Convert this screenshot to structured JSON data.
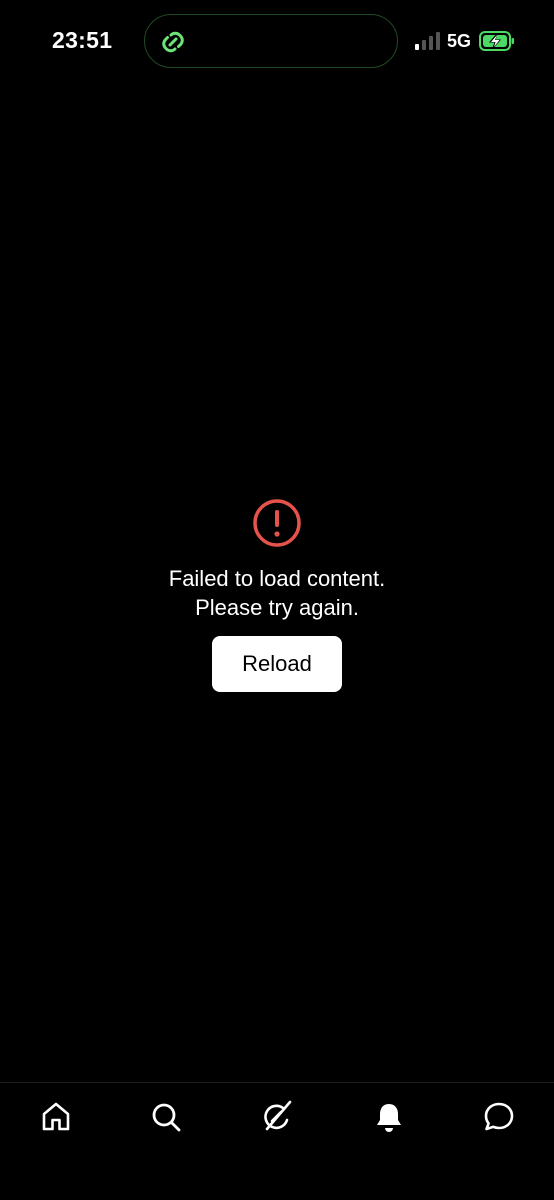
{
  "status_bar": {
    "time": "23:51",
    "network": "5G",
    "island_icon": "link-icon",
    "colors": {
      "island_accent": "#6ee37a",
      "battery": "#4cd964"
    }
  },
  "error": {
    "icon": "alert-circle-icon",
    "color": "#e5534b",
    "message_line1": "Failed to load content.",
    "message_line2": "Please try again.",
    "reload_label": "Reload"
  },
  "tab_bar": {
    "items": [
      {
        "icon": "home-icon",
        "selected": false
      },
      {
        "icon": "search-icon",
        "selected": false
      },
      {
        "icon": "grok-icon",
        "selected": false
      },
      {
        "icon": "bell-icon",
        "selected": false
      },
      {
        "icon": "chat-bubble-icon",
        "selected": false
      }
    ]
  }
}
